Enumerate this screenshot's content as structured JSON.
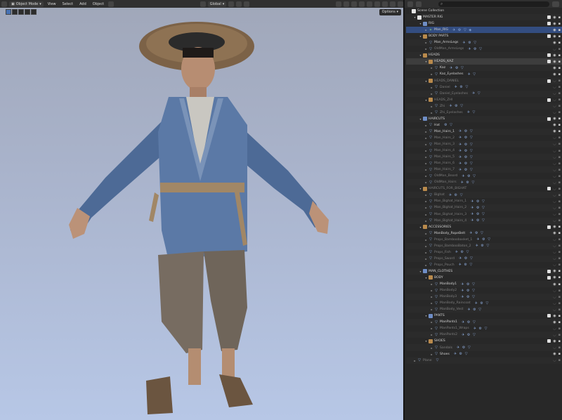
{
  "header": {
    "mode": "Object Mode",
    "menus": [
      "View",
      "Select",
      "Add",
      "Object"
    ],
    "transform_orientation": "Global",
    "options_label": "Options"
  },
  "outliner": {
    "search_placeholder": "",
    "rows": [
      {
        "depth": 0,
        "label": "Scene Collection",
        "icon": "collection",
        "tw": ""
      },
      {
        "depth": 1,
        "label": "MASTER RIG",
        "icon": "collection",
        "tw": "▾",
        "chk": true
      },
      {
        "depth": 2,
        "label": "RIG",
        "icon": "collection",
        "color": "blue",
        "tw": "▾",
        "chk": true
      },
      {
        "depth": 3,
        "label": "Man_RIG",
        "icon": "armature",
        "tw": "▸",
        "sel": true,
        "mods": "✈ ⚙ ▽ ◈"
      },
      {
        "depth": 2,
        "label": "BODY PARTS",
        "icon": "collection",
        "color": "orange",
        "tw": "▾",
        "chk": true
      },
      {
        "depth": 3,
        "label": "Man_ArmsLegs",
        "icon": "mesh",
        "tw": "▸",
        "mods": "✈ ⚙ ▽"
      },
      {
        "depth": 3,
        "label": "OldMan_ArmsLegs",
        "icon": "mesh",
        "tw": "▸",
        "dim": true,
        "mods": "✈ ⚙ ▽"
      },
      {
        "depth": 2,
        "label": "HEADS",
        "icon": "collection",
        "color": "orange",
        "tw": "▾",
        "chk": true
      },
      {
        "depth": 3,
        "label": "HEADS_KAZ",
        "icon": "collection",
        "color": "orange",
        "tw": "▾",
        "hl": true,
        "chk": true
      },
      {
        "depth": 4,
        "label": "Kaz",
        "icon": "mesh",
        "tw": "▸",
        "mods": "✈ ⚙ ▽"
      },
      {
        "depth": 4,
        "label": "Kaz_Eyelashes",
        "icon": "mesh",
        "tw": "▸",
        "mods": "✈ ▽"
      },
      {
        "depth": 3,
        "label": "HEADS_DANIEL",
        "icon": "collection",
        "color": "orange",
        "tw": "▾",
        "dim": true,
        "chk": true
      },
      {
        "depth": 4,
        "label": "Daniel",
        "icon": "mesh",
        "tw": "▸",
        "dim": true,
        "mods": "✈ ⚙ ▽"
      },
      {
        "depth": 4,
        "label": "Daniel_Eyelashes",
        "icon": "mesh",
        "tw": "▸",
        "dim": true,
        "mods": "✈ ▽"
      },
      {
        "depth": 3,
        "label": "HEADS_ZHI",
        "icon": "collection",
        "color": "orange",
        "tw": "▾",
        "dim": true,
        "chk": true
      },
      {
        "depth": 4,
        "label": "Zhi",
        "icon": "mesh",
        "tw": "▸",
        "dim": true,
        "mods": "✈ ⚙ ▽"
      },
      {
        "depth": 4,
        "label": "Zhi_Eyelashes",
        "icon": "mesh",
        "tw": "▸",
        "dim": true,
        "mods": "✈ ▽"
      },
      {
        "depth": 2,
        "label": "HAIRCUTS",
        "icon": "collection",
        "color": "blue",
        "tw": "▾",
        "chk": true
      },
      {
        "depth": 3,
        "label": "Hat",
        "icon": "mesh",
        "tw": "▸",
        "mods": "⚙ ▽"
      },
      {
        "depth": 3,
        "label": "Man_Hairs_1",
        "icon": "mesh",
        "tw": "▸",
        "mods": "✈ ⚙ ▽"
      },
      {
        "depth": 3,
        "label": "Man_Hairs_2",
        "icon": "mesh",
        "tw": "▸",
        "dim": true,
        "mods": "✈ ⚙ ▽"
      },
      {
        "depth": 3,
        "label": "Man_Hairs_3",
        "icon": "mesh",
        "tw": "▸",
        "dim": true,
        "mods": "✈ ⚙ ▽"
      },
      {
        "depth": 3,
        "label": "Man_Hairs_4",
        "icon": "mesh",
        "tw": "▸",
        "dim": true,
        "mods": "✈ ⚙ ▽"
      },
      {
        "depth": 3,
        "label": "Man_Hairs_5",
        "icon": "mesh",
        "tw": "▸",
        "dim": true,
        "mods": "✈ ⚙ ▽"
      },
      {
        "depth": 3,
        "label": "Man_Hairs_6",
        "icon": "mesh",
        "tw": "▸",
        "dim": true,
        "mods": "✈ ⚙ ▽"
      },
      {
        "depth": 3,
        "label": "Man_Hairs_7",
        "icon": "mesh",
        "tw": "▸",
        "dim": true,
        "mods": "✈ ⚙ ▽"
      },
      {
        "depth": 3,
        "label": "OldMan_Beard",
        "icon": "mesh",
        "tw": "▸",
        "dim": true,
        "mods": "✈ ⚙ ▽"
      },
      {
        "depth": 3,
        "label": "OldMan_Hairs",
        "icon": "mesh",
        "tw": "▸",
        "dim": true,
        "mods": "✈ ⚙ ▽"
      },
      {
        "depth": 2,
        "label": "HAIRCUTS_FOR_BIGHAT",
        "icon": "collection",
        "color": "orange",
        "tw": "▾",
        "dim": true,
        "chk": true
      },
      {
        "depth": 3,
        "label": "Bighat",
        "icon": "mesh",
        "tw": "▸",
        "dim": true,
        "mods": "✈ ⚙ ▽"
      },
      {
        "depth": 3,
        "label": "Man_Bighat_Hairs_1",
        "icon": "mesh",
        "tw": "▸",
        "dim": true,
        "mods": "✈ ⚙ ▽"
      },
      {
        "depth": 3,
        "label": "Man_Bighat_Hairs_2",
        "icon": "mesh",
        "tw": "▸",
        "dim": true,
        "mods": "✈ ⚙ ▽"
      },
      {
        "depth": 3,
        "label": "Man_Bighat_Hairs_3",
        "icon": "mesh",
        "tw": "▸",
        "dim": true,
        "mods": "✈ ⚙ ▽"
      },
      {
        "depth": 3,
        "label": "Man_Bighat_Hairs_4",
        "icon": "mesh",
        "tw": "▸",
        "dim": true,
        "mods": "✈ ⚙ ▽"
      },
      {
        "depth": 2,
        "label": "ACCESSORIES",
        "icon": "collection",
        "color": "orange",
        "tw": "▾",
        "chk": true
      },
      {
        "depth": 3,
        "label": "ManBody_RopeBelt",
        "icon": "mesh",
        "tw": "▸",
        "mods": "✈ ⚙ ▽"
      },
      {
        "depth": 3,
        "label": "Props_Bamboobasket_1",
        "icon": "mesh",
        "tw": "▸",
        "dim": true,
        "mods": "✈ ⚙ ▽"
      },
      {
        "depth": 3,
        "label": "Props_BambooBaton_2",
        "icon": "mesh",
        "tw": "▸",
        "dim": true,
        "mods": "✈ ⚙ ▽"
      },
      {
        "depth": 3,
        "label": "Props_Fish",
        "icon": "mesh",
        "tw": "▸",
        "dim": true,
        "mods": "✈ ⚙ ▽"
      },
      {
        "depth": 3,
        "label": "Props_Sword",
        "icon": "mesh",
        "tw": "▸",
        "dim": true,
        "mods": "✈ ⚙ ▽"
      },
      {
        "depth": 3,
        "label": "Props_Pouch",
        "icon": "mesh",
        "tw": "▸",
        "dim": true,
        "mods": "✈ ⚙ ▽"
      },
      {
        "depth": 2,
        "label": "MAN_CLOTHES",
        "icon": "collection",
        "color": "blue",
        "tw": "▾",
        "chk": true
      },
      {
        "depth": 3,
        "label": "BODY",
        "icon": "collection",
        "color": "orange",
        "tw": "▾",
        "chk": true
      },
      {
        "depth": 4,
        "label": "ManBody1",
        "icon": "mesh",
        "tw": "▸",
        "mods": "✈ ⚙ ▽"
      },
      {
        "depth": 4,
        "label": "ManBody2",
        "icon": "mesh",
        "tw": "▸",
        "dim": true,
        "mods": "✈ ⚙ ▽"
      },
      {
        "depth": 4,
        "label": "ManBody3",
        "icon": "mesh",
        "tw": "▸",
        "dim": true,
        "mods": "✈ ⚙ ▽"
      },
      {
        "depth": 4,
        "label": "ManBody_Raincoat",
        "icon": "mesh",
        "tw": "▸",
        "dim": true,
        "mods": "✈ ⚙ ▽"
      },
      {
        "depth": 4,
        "label": "ManBody_Vest",
        "icon": "mesh",
        "tw": "▸",
        "dim": true,
        "mods": "✈ ⚙ ▽"
      },
      {
        "depth": 3,
        "label": "PANTS",
        "icon": "collection",
        "color": "blue",
        "tw": "▾",
        "chk": true
      },
      {
        "depth": 4,
        "label": "ManPants1",
        "icon": "mesh",
        "tw": "▸",
        "mods": "✈ ⚙ ▽"
      },
      {
        "depth": 4,
        "label": "ManPants1_Wraps",
        "icon": "mesh",
        "tw": "▸",
        "dim": true,
        "mods": "✈ ⚙ ▽"
      },
      {
        "depth": 4,
        "label": "ManPants2",
        "icon": "mesh",
        "tw": "▸",
        "dim": true,
        "mods": "✈ ⚙ ▽"
      },
      {
        "depth": 3,
        "label": "SHOES",
        "icon": "collection",
        "color": "orange",
        "tw": "▾",
        "chk": true
      },
      {
        "depth": 4,
        "label": "Sandals",
        "icon": "mesh",
        "tw": "▸",
        "dim": true,
        "mods": "✈ ⚙ ▽"
      },
      {
        "depth": 4,
        "label": "Shoes",
        "icon": "mesh",
        "tw": "▸",
        "mods": "✈ ⚙ ▽"
      },
      {
        "depth": 1,
        "label": "Plane",
        "icon": "mesh",
        "tw": "▸",
        "dim": true,
        "mods": "▽"
      }
    ]
  }
}
